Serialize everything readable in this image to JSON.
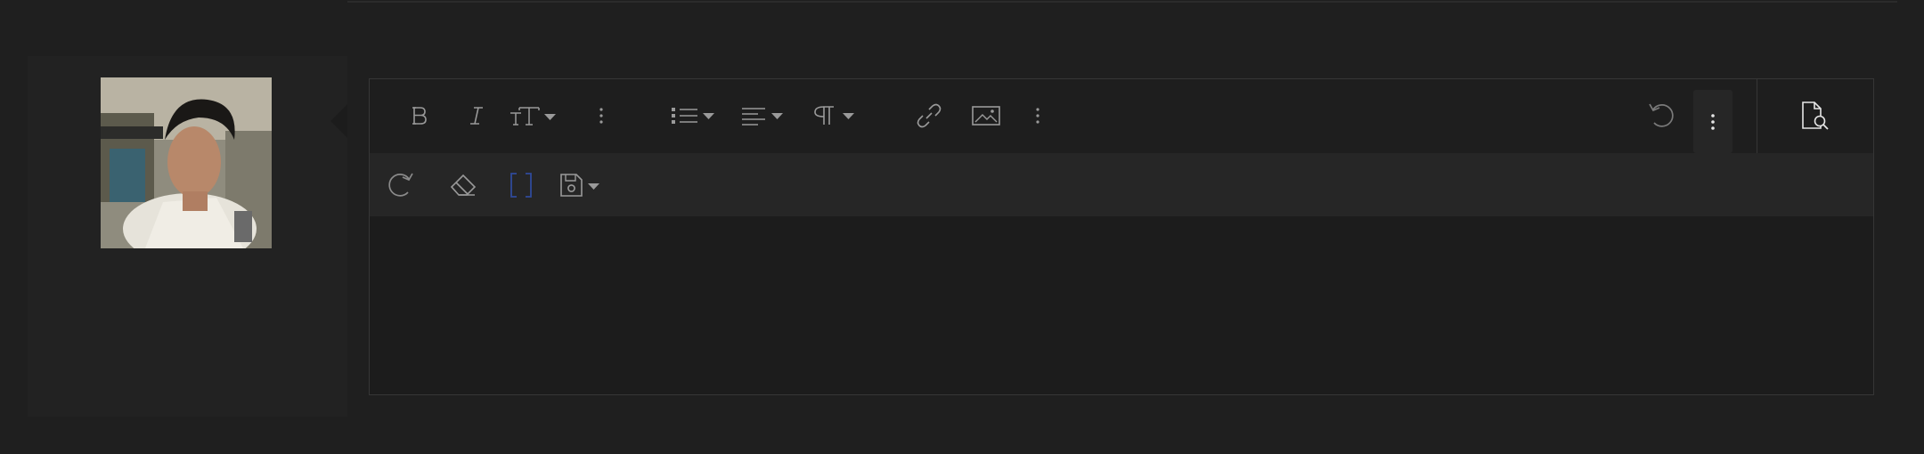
{
  "user_panel": {
    "avatar_icon": "user-avatar-photo"
  },
  "editor": {
    "toolbar": {
      "row1": [
        {
          "icon": "bold-icon"
        },
        {
          "icon": "italic-icon"
        },
        {
          "icon": "font-size-icon",
          "dropdown": true
        },
        {
          "icon": "more-text-options-icon"
        },
        {
          "icon": "list-icon",
          "dropdown": true
        },
        {
          "icon": "align-icon",
          "dropdown": true
        },
        {
          "icon": "paragraph-format-icon",
          "dropdown": true
        },
        {
          "icon": "insert-link-icon"
        },
        {
          "icon": "insert-image-icon"
        },
        {
          "icon": "more-insert-options-icon"
        },
        {
          "icon": "undo-icon"
        },
        {
          "icon": "more-toolbar-icon",
          "active": true
        },
        {
          "icon": "preview-icon"
        }
      ],
      "row2": [
        {
          "icon": "redo-icon"
        },
        {
          "icon": "clear-formatting-icon"
        },
        {
          "icon": "bbcode-toggle-icon",
          "color": "#2f4a9a"
        },
        {
          "icon": "save-draft-icon",
          "dropdown": true
        }
      ]
    },
    "content": ""
  },
  "colors": {
    "background": "#1f1f1f",
    "panel": "#222222",
    "toolbar_row2": "#262626",
    "icon": "#9a9a9a",
    "bbcode_accent": "#2f4a9a",
    "preview_icon": "#e6e6e6"
  }
}
